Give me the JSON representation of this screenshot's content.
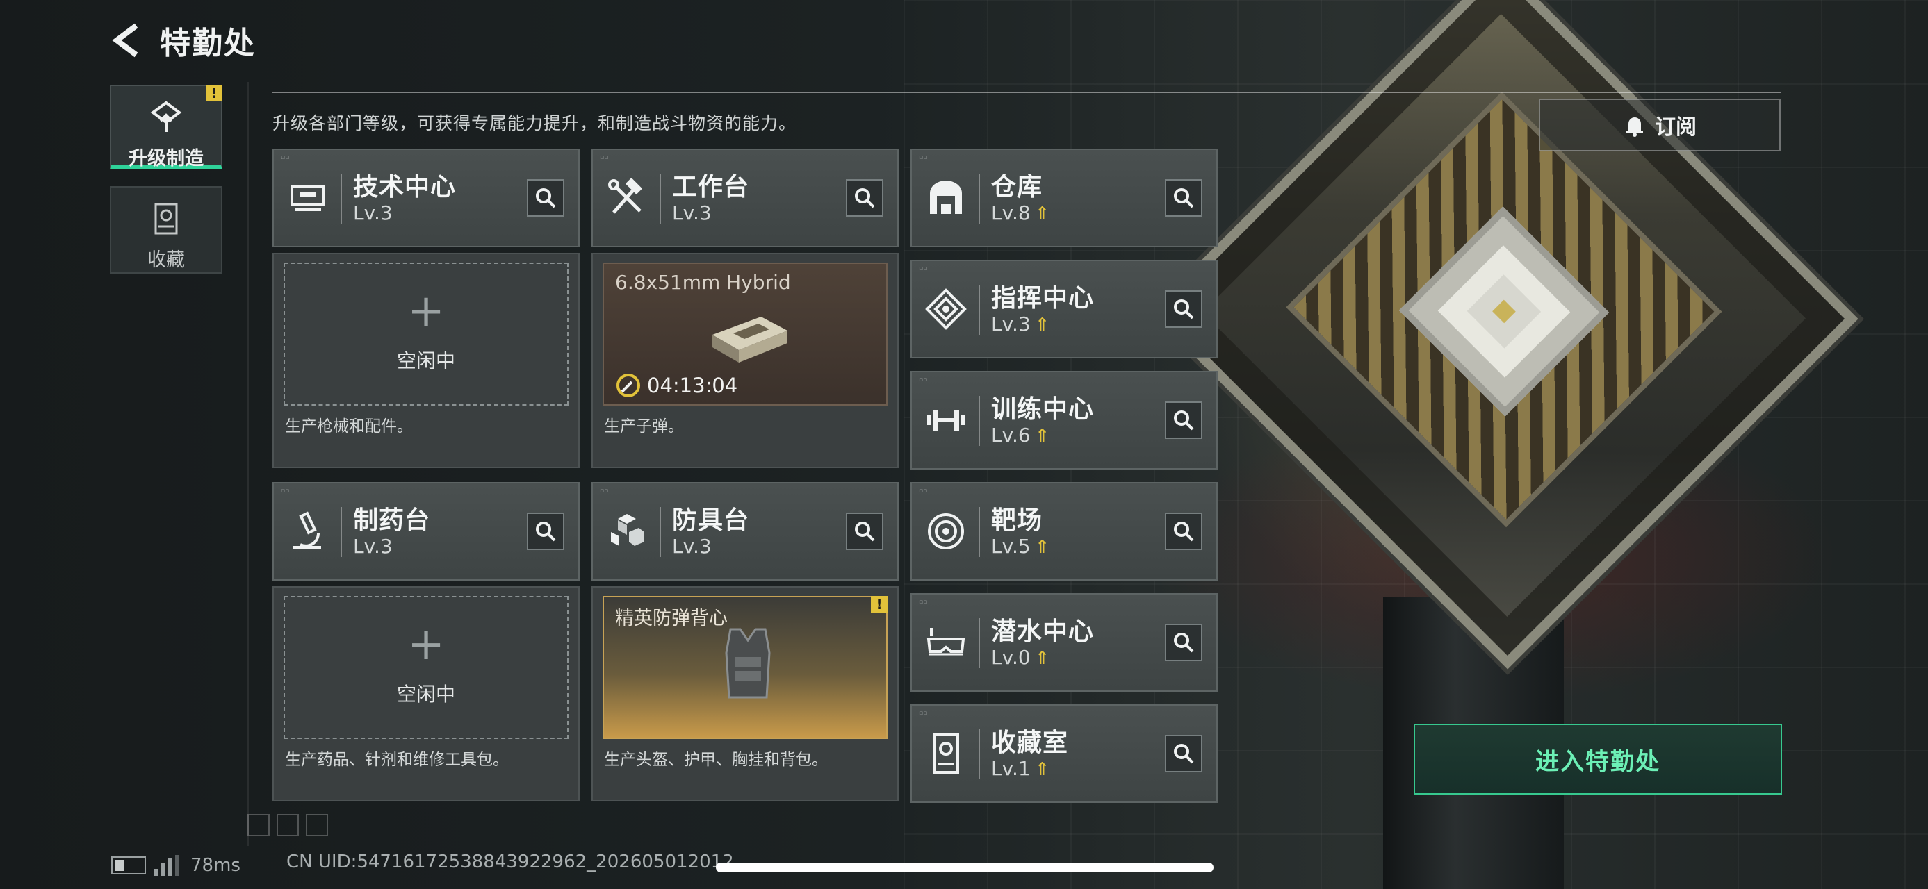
{
  "header": {
    "title": "特勤处"
  },
  "tabs": [
    {
      "label": "升级制造",
      "active": true,
      "alert": "!"
    },
    {
      "label": "收藏",
      "active": false
    }
  ],
  "description": "升级各部门等级，可获得专属能力提升，和制造战斗物资的能力。",
  "subscribe": {
    "label": "订阅"
  },
  "stations": [
    {
      "name": "技术中心",
      "level": "Lv.3",
      "icon": "computer-icon"
    },
    {
      "name": "工作台",
      "level": "Lv.3",
      "icon": "hammer-wrench-icon"
    },
    {
      "name": "制药台",
      "level": "Lv.3",
      "icon": "microscope-icon"
    },
    {
      "name": "防具台",
      "level": "Lv.3",
      "icon": "cubes-icon"
    }
  ],
  "facilities": [
    {
      "name": "仓库",
      "level": "Lv.8",
      "upgradable": true,
      "icon": "warehouse-icon"
    },
    {
      "name": "指挥中心",
      "level": "Lv.3",
      "upgradable": true,
      "icon": "command-icon"
    },
    {
      "name": "训练中心",
      "level": "Lv.6",
      "upgradable": true,
      "icon": "dumbbell-icon"
    },
    {
      "name": "靶场",
      "level": "Lv.5",
      "upgradable": true,
      "icon": "target-icon"
    },
    {
      "name": "潜水中心",
      "level": "Lv.0",
      "upgradable": true,
      "icon": "diving-mask-icon"
    },
    {
      "name": "收藏室",
      "level": "Lv.1",
      "upgradable": true,
      "icon": "trophy-case-icon"
    }
  ],
  "slots": {
    "tech": {
      "status": "空闲中",
      "desc": "生产枪械和配件。"
    },
    "workbench": {
      "product": "6.8x51mm Hybrid",
      "timer": "04:13:04",
      "desc": "生产子弹。"
    },
    "pharmacy": {
      "status": "空闲中",
      "desc": "生产药品、针剂和维修工具包。"
    },
    "armor": {
      "product": "精英防弹背心",
      "alert": "!",
      "desc": "生产头盔、护甲、胸挂和背包。"
    }
  },
  "enter_button": {
    "label": "进入特勤处"
  },
  "footer": {
    "ping": "78ms",
    "uid": "CN UID:5471617253884392​2962_202605012012"
  },
  "colors": {
    "accent": "#2fd39a",
    "warning": "#e2c23a",
    "enter_text": "#6cf0b6"
  }
}
